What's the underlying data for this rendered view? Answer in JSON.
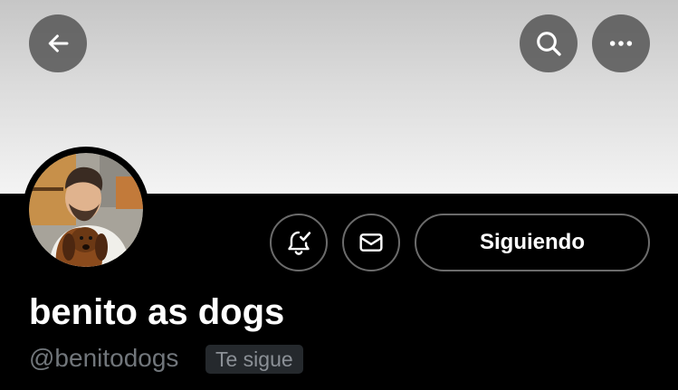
{
  "header": {
    "back_icon": "arrow-left-icon",
    "search_icon": "search-icon",
    "more_icon": "more-horizontal-icon"
  },
  "profile": {
    "display_name": "benito as dogs",
    "handle": "@benitodogs",
    "follows_you_label": "Te sigue",
    "following_button_label": "Siguiendo",
    "notifications_icon": "bell-check-icon",
    "message_icon": "envelope-icon"
  },
  "colors": {
    "background": "#000000",
    "button_overlay": "#505050",
    "secondary_text": "#71767b",
    "badge_background": "#25292d"
  }
}
